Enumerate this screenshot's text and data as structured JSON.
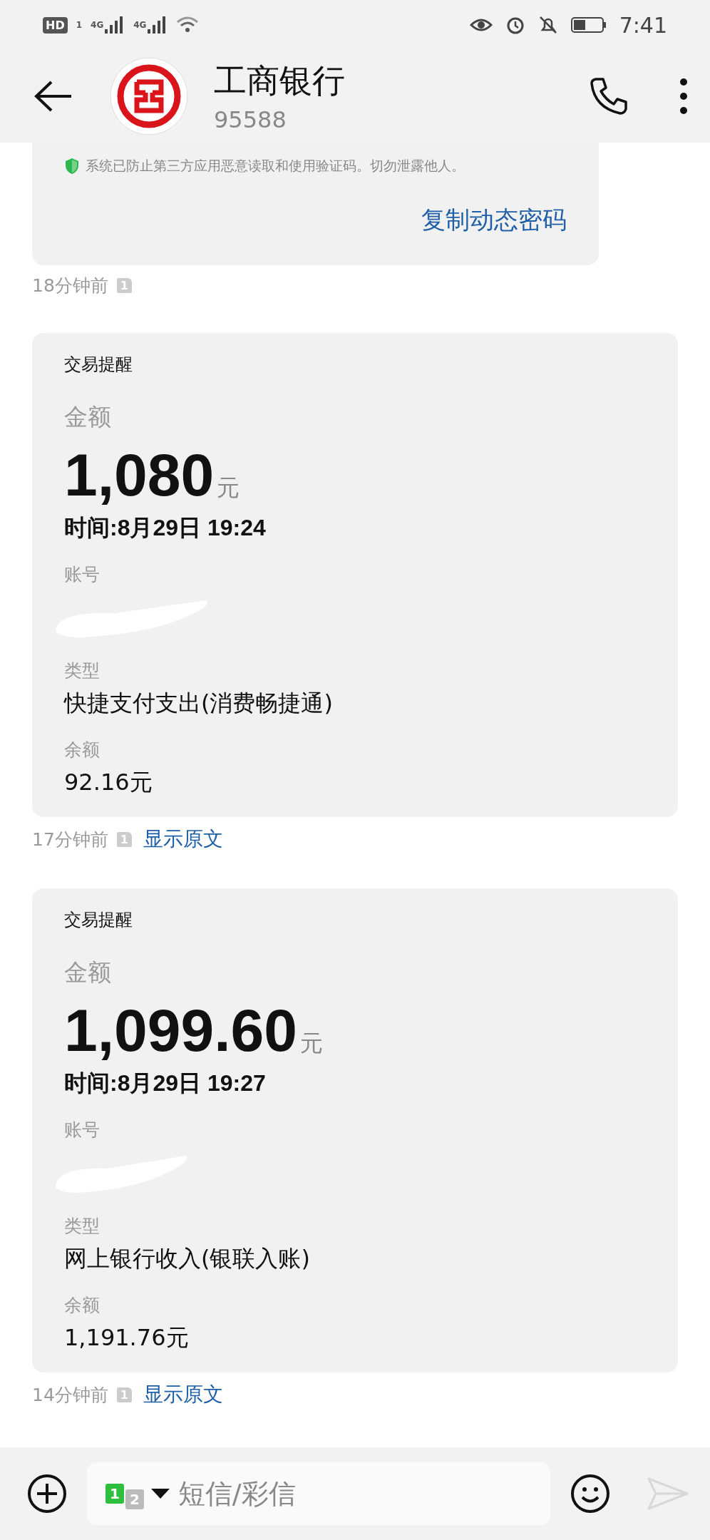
{
  "status_bar": {
    "hd": "HD",
    "sim_slot": "1",
    "signals": [
      {
        "network": "4G"
      },
      {
        "network": "4G"
      }
    ],
    "time": "7:41"
  },
  "header": {
    "contact_name": "工商银行",
    "number": "95588"
  },
  "messages": [
    {
      "kind": "otp",
      "notice": "系统已防止第三方应用恶意读取和使用验证码。切勿泄露他人。",
      "action": "复制动态密码",
      "time": "18分钟前",
      "sim": "1"
    },
    {
      "kind": "transaction",
      "title": "交易提醒",
      "amount_label": "金额",
      "amount": "1,080",
      "currency": "元",
      "datetime": "时间:8月29日 19:24",
      "account_label": "账号",
      "type_label": "类型",
      "type": "快捷支付支出(消费畅捷通)",
      "balance_label": "余额",
      "balance": "92.16元",
      "time": "17分钟前",
      "sim": "1",
      "link": "显示原文"
    },
    {
      "kind": "transaction",
      "title": "交易提醒",
      "amount_label": "金额",
      "amount": "1,099.60",
      "currency": "元",
      "datetime": "时间:8月29日 19:27",
      "account_label": "账号",
      "type_label": "类型",
      "type": "网上银行收入(银联入账)",
      "balance_label": "余额",
      "balance": "1,191.76元",
      "time": "14分钟前",
      "sim": "1",
      "link": "显示原文"
    }
  ],
  "composer": {
    "sim_primary": "1",
    "sim_secondary": "2",
    "placeholder": "短信/彩信",
    "send_disabled": true
  }
}
